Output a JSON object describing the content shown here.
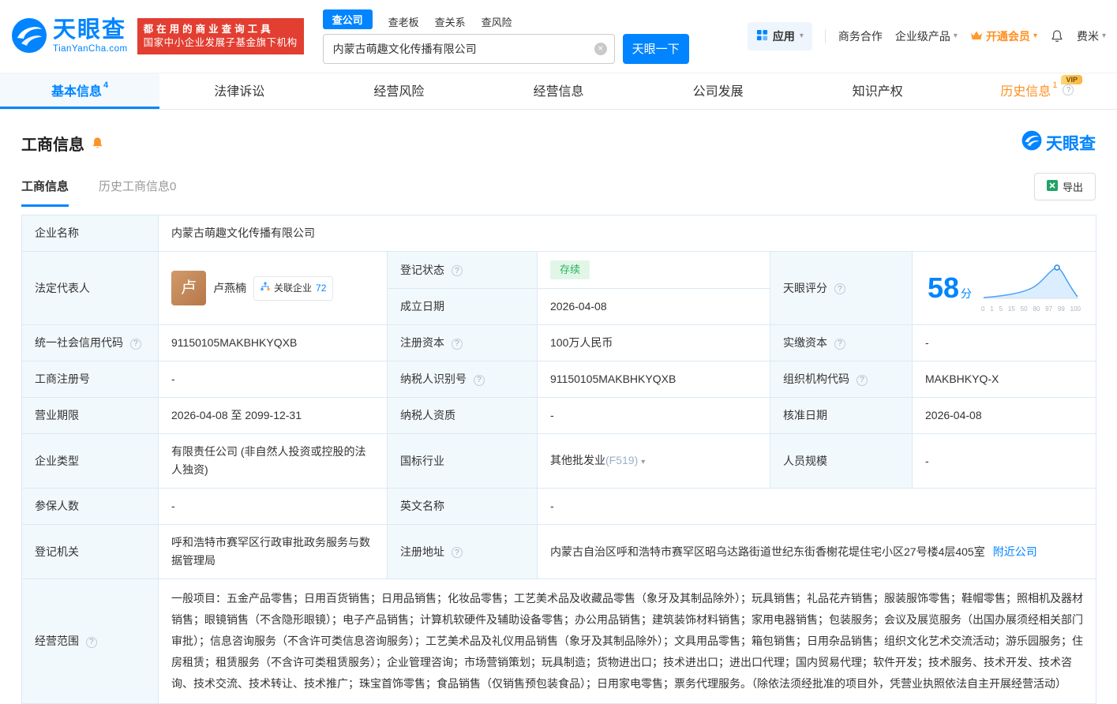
{
  "icons": {
    "help": "?",
    "caret": "▾",
    "clear": "×"
  },
  "header": {
    "logo": {
      "name": "天眼查",
      "domain": "TianYanCha.com"
    },
    "slogan_line1": "都在用的商业查询工具",
    "slogan_line2": "国家中小企业发展子基金旗下机构",
    "search_tabs": [
      {
        "label": "查公司"
      },
      {
        "label": "查老板"
      },
      {
        "label": "查关系"
      },
      {
        "label": "查风险"
      }
    ],
    "search_value": "内蒙古萌趣文化传播有限公司",
    "search_button": "天眼一下",
    "nav": {
      "apps": "应用",
      "biz": "商务合作",
      "enterprise": "企业级产品",
      "vip": "开通会员",
      "user": "费米"
    }
  },
  "tabs": [
    {
      "label": "基本信息",
      "count": "4"
    },
    {
      "label": "法律诉讼"
    },
    {
      "label": "经营风险"
    },
    {
      "label": "经营信息"
    },
    {
      "label": "公司发展"
    },
    {
      "label": "知识产权"
    },
    {
      "label": "历史信息",
      "count": "1",
      "vip_badge": "VIP"
    }
  ],
  "section": {
    "title": "工商信息",
    "brand": "天眼查",
    "subtab_active": "工商信息",
    "subtab_inactive": "历史工商信息0",
    "export": "导出"
  },
  "info": {
    "company_name_label": "企业名称",
    "company_name": "内蒙古萌趣文化传播有限公司",
    "legal_rep_label": "法定代表人",
    "avatar_char": "卢",
    "legal_rep": "卢燕楠",
    "related_label": "关联企业",
    "related_count": "72",
    "status_label": "登记状态",
    "status_value": "存续",
    "established_label": "成立日期",
    "established_value": "2026-04-08",
    "score_label": "天眼评分",
    "score_value": "58",
    "score_unit": "分",
    "score_axis": [
      "0",
      "1",
      "5",
      "15",
      "50",
      "80",
      "97",
      "99",
      "100"
    ],
    "uscc_label": "统一社会信用代码",
    "uscc_value": "91150105MAKBHKYQXB",
    "reg_capital_label": "注册资本",
    "reg_capital_value": "100万人民币",
    "paid_capital_label": "实缴资本",
    "paid_capital_value": "-",
    "reg_no_label": "工商注册号",
    "reg_no_value": "-",
    "taxpayer_id_label": "纳税人识别号",
    "taxpayer_id_value": "91150105MAKBHKYQXB",
    "org_code_label": "组织机构代码",
    "org_code_value": "MAKBHKYQ-X",
    "term_label": "营业期限",
    "term_value": "2026-04-08 至 2099-12-31",
    "taxpayer_quality_label": "纳税人资质",
    "taxpayer_quality_value": "-",
    "approval_date_label": "核准日期",
    "approval_date_value": "2026-04-08",
    "company_type_label": "企业类型",
    "company_type_value": "有限责任公司 (非自然人投资或控股的法人独资)",
    "industry_label": "国标行业",
    "industry_value": "其他批发业",
    "industry_code": "(F519)",
    "staff_label": "人员规模",
    "staff_value": "-",
    "insured_label": "参保人数",
    "insured_value": "-",
    "english_name_label": "英文名称",
    "english_name_value": "-",
    "authority_label": "登记机关",
    "authority_value": "呼和浩特市赛罕区行政审批政务服务与数据管理局",
    "address_label": "注册地址",
    "address_value": "内蒙古自治区呼和浩特市赛罕区昭乌达路街道世纪东街香榭花堤住宅小区27号楼4层405室",
    "nearby_link": "附近公司",
    "scope_label": "经营范围",
    "scope_value": "一般项目：五金产品零售；日用百货销售；日用品销售；化妆品零售；工艺美术品及收藏品零售（象牙及其制品除外）；玩具销售；礼品花卉销售；服装服饰零售；鞋帽零售；照相机及器材销售；眼镜销售（不含隐形眼镜）；电子产品销售；计算机软硬件及辅助设备零售；办公用品销售；建筑装饰材料销售；家用电器销售；包装服务；会议及展览服务（出国办展须经相关部门审批）；信息咨询服务（不含许可类信息咨询服务）；工艺美术品及礼仪用品销售（象牙及其制品除外）；文具用品零售；箱包销售；日用杂品销售；组织文化艺术交流活动；游乐园服务；住房租赁；租赁服务（不含许可类租赁服务）；企业管理咨询；市场营销策划；玩具制造；货物进出口；技术进出口；进出口代理；国内贸易代理；软件开发；技术服务、技术开发、技术咨询、技术交流、技术转让、技术推广；珠宝首饰零售；食品销售（仅销售预包装食品）；日用家电零售；票务代理服务。（除依法须经批准的项目外，凭营业执照依法自主开展经营活动）"
  }
}
